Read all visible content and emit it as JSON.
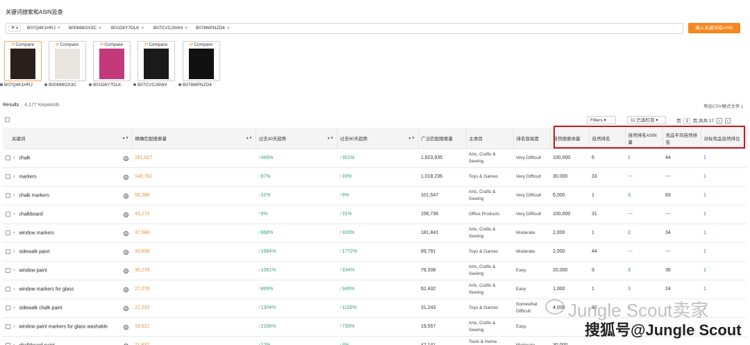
{
  "header": {
    "title": "关键词搜索和ASIN监查"
  },
  "search": {
    "marketplace": "⚑ ▾",
    "asins": [
      "B07Q4K1HRJ",
      "B00MI8OX3C",
      "B01D8Y7DLK",
      "B07CVC26W4",
      "B076MPNZD4"
    ],
    "find_button": "输入关键词或ASIN"
  },
  "products": [
    {
      "compare": "Compare",
      "asin": "B07Q4K1HRJ",
      "color": "#2a1f1a"
    },
    {
      "compare": "Compare",
      "asin": "B00MI8OX3C",
      "color": "#e8e4e0"
    },
    {
      "compare": "Compare",
      "asin": "B01D8Y7DLK",
      "color": "#c23a7a"
    },
    {
      "compare": "Compare",
      "asin": "B07CVC26W4",
      "color": "#1a1a1a"
    },
    {
      "compare": "Compare",
      "asin": "B076MPNZD4",
      "color": "#111111"
    }
  ],
  "results": {
    "label": "Results",
    "count": "4,177 Keywords",
    "export": "导出CSV格式文件 ⤓"
  },
  "toolbar": {
    "filters": "Filters ▾",
    "columns": "11 已选栏目 ▾",
    "page_label": "页",
    "page": "1",
    "page_total": "页,共共 17",
    "prev": "‹",
    "next": "›"
  },
  "table": {
    "headers": [
      "关键词",
      "精确匹配搜索量",
      "过去30天趋势",
      "过去90天趋势",
      "广泛匹配搜索量",
      "主类目",
      "排名容易度",
      "自然搜索体量",
      "自然排名",
      "自然排名ASIN量",
      "竞品平均自然排名",
      "对标竞品自然排位"
    ],
    "rows": [
      {
        "kw": "chalk",
        "exact": "261,027",
        "t30": "↑449%",
        "t90": "↑301%",
        "broad": "1,823,935",
        "cat": "Arts, Crafts & Sewing",
        "diff": "Very Difficult",
        "vol": "100,000",
        "rank": "6",
        "asins": "1",
        "avg": "44",
        "comp": "1"
      },
      {
        "kw": "markers",
        "exact": "140,781",
        "t30": "↑87%",
        "t90": "↑33%",
        "broad": "1,018,236",
        "cat": "Toys & Games",
        "diff": "Very Difficult",
        "vol": "30,000",
        "rank": "33",
        "asins": "---",
        "avg": "---",
        "comp": "1"
      },
      {
        "kw": "chalk markers",
        "exact": "56,388",
        "t30": "↑31%",
        "t90": "↑9%",
        "broad": "101,547",
        "cat": "Arts, Crafts & Sewing",
        "diff": "Very Difficult",
        "vol": "6,000",
        "rank": "1",
        "asins": "3",
        "avg": "83",
        "comp": "1"
      },
      {
        "kw": "chalkboard",
        "exact": "43,272",
        "t30": "↑6%",
        "t90": "↑31%",
        "broad": "156,736",
        "cat": "Office Products",
        "diff": "Very Difficult",
        "vol": "100,000",
        "rank": "31",
        "asins": "---",
        "avg": "---",
        "comp": "1"
      },
      {
        "kw": "window markers",
        "exact": "37,588",
        "t30": "↑868%",
        "t90": "↑333%",
        "broad": "181,841",
        "cat": "Arts, Crafts & Sewing",
        "diff": "Moderate",
        "vol": "2,000",
        "rank": "1",
        "asins": "2",
        "avg": "34",
        "comp": "1"
      },
      {
        "kw": "sidewalk paint",
        "exact": "33,838",
        "t30": "↑1684%",
        "t90": "↑1772%",
        "broad": "89,791",
        "cat": "Toys & Games",
        "diff": "Moderate",
        "vol": "2,000",
        "rank": "44",
        "asins": "---",
        "avg": "---",
        "comp": "1"
      },
      {
        "kw": "window paint",
        "exact": "30,278",
        "t30": "↑1081%",
        "t90": "↑334%",
        "broad": "78,338",
        "cat": "Arts, Crafts & Sewing",
        "diff": "Easy",
        "vol": "20,000",
        "rank": "9",
        "asins": "3",
        "avg": "36",
        "comp": "1"
      },
      {
        "kw": "window markers for glass",
        "exact": "27,278",
        "t30": "↑889%",
        "t90": "↑349%",
        "broad": "62,432",
        "cat": "Arts, Crafts & Sewing",
        "diff": "Easy",
        "vol": "1,000",
        "rank": "1",
        "asins": "3",
        "avg": "24",
        "comp": "1"
      },
      {
        "kw": "sidewalk chalk paint",
        "exact": "22,232",
        "t30": "↑1304%",
        "t90": "↑1100%",
        "broad": "31,243",
        "cat": "Toys & Games",
        "diff": "Somewhat Difficult",
        "vol": "4,000",
        "rank": "80",
        "asins": "---",
        "avg": "---",
        "comp": "1"
      },
      {
        "kw": "window paint markers for glass washable",
        "exact": "16,621",
        "t30": "↑2166%",
        "t90": "↑730%",
        "broad": "19,557",
        "cat": "Arts, Crafts & Sewing",
        "diff": "Easy",
        "vol": "",
        "rank": "",
        "asins": "",
        "avg": "",
        "comp": ""
      },
      {
        "kw": "chalkboard paint",
        "exact": "11,837",
        "t30": "↑12%",
        "t90": "↑4%",
        "broad": "42,141",
        "cat": "Tools & Home Improvement",
        "diff": "Moderate",
        "vol": "30,000",
        "rank": "",
        "asins": "",
        "avg": "",
        "comp": ""
      }
    ]
  },
  "watermark": {
    "line1": "Jungle Scout卖家",
    "line2": "搜狐号@Jungle Scout"
  }
}
